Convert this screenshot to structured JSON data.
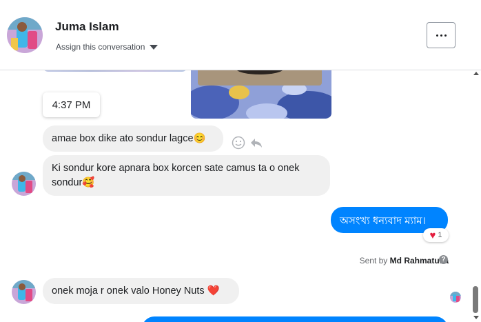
{
  "header": {
    "contact_name": "Juma Islam",
    "assign_label": "Assign this conversation",
    "more_button_label": "More actions"
  },
  "chat": {
    "time_divider": "4:37 PM",
    "messages": [
      {
        "sender": "contact",
        "text": "amae box dike ato sondur lagce😊"
      },
      {
        "sender": "contact",
        "text": "Ki sondur kore apnara box korcen sate camus ta o onek sondur🥰"
      },
      {
        "sender": "page",
        "text": "অসংখ্য ধন্যবাদ ম্যাম।",
        "reaction": {
          "emoji": "❤️",
          "count": "1"
        }
      },
      {
        "sender": "contact",
        "text": "onek moja r onek valo Honey Nuts ❤️"
      }
    ],
    "sent_by_prefix": "Sent by",
    "sent_by_name": "Md Rahmatulla",
    "help_glyph": "?"
  },
  "colors": {
    "outgoing_bubble": "#0084ff",
    "incoming_bubble": "#f0f0f0",
    "heart": "#e41e3f"
  }
}
